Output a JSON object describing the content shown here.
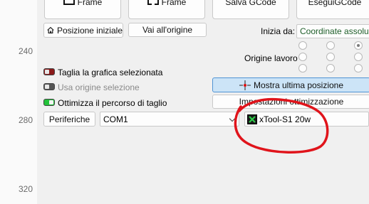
{
  "ruler": {
    "marks": [
      "240",
      "280",
      "320"
    ]
  },
  "toolbar": {
    "frame1_label": "Frame",
    "frame2_label": "Frame",
    "save_gcode_label": "Salva GCode",
    "run_gcode_label": "EseguiGCode"
  },
  "position": {
    "home_label": "Posizione iniziale",
    "goto_origin_label": "Vai all'origine",
    "start_from_label": "Inizia da:",
    "start_from_value": "Coordinate assolute",
    "origin_label": "Origine lavoro"
  },
  "options": {
    "cut_selected": "Taglia la grafica selezionata",
    "use_selection_origin": "Usa origine selezione",
    "optimize_path": "Ottimizza il percorso di taglio"
  },
  "buttons": {
    "show_last_position": "Mostra ultima posizione",
    "optimization_settings": "Impostazioni ottimizzazione"
  },
  "device": {
    "devices_label": "Periferiche",
    "port_value": "COM1",
    "device_name": "xTool-S1 20w"
  },
  "colors": {
    "accent_blue": "#cce4f7",
    "annotation_red": "#e0141b",
    "toggle_green": "#23c23a",
    "toggle_red": "#8b1a1a"
  }
}
